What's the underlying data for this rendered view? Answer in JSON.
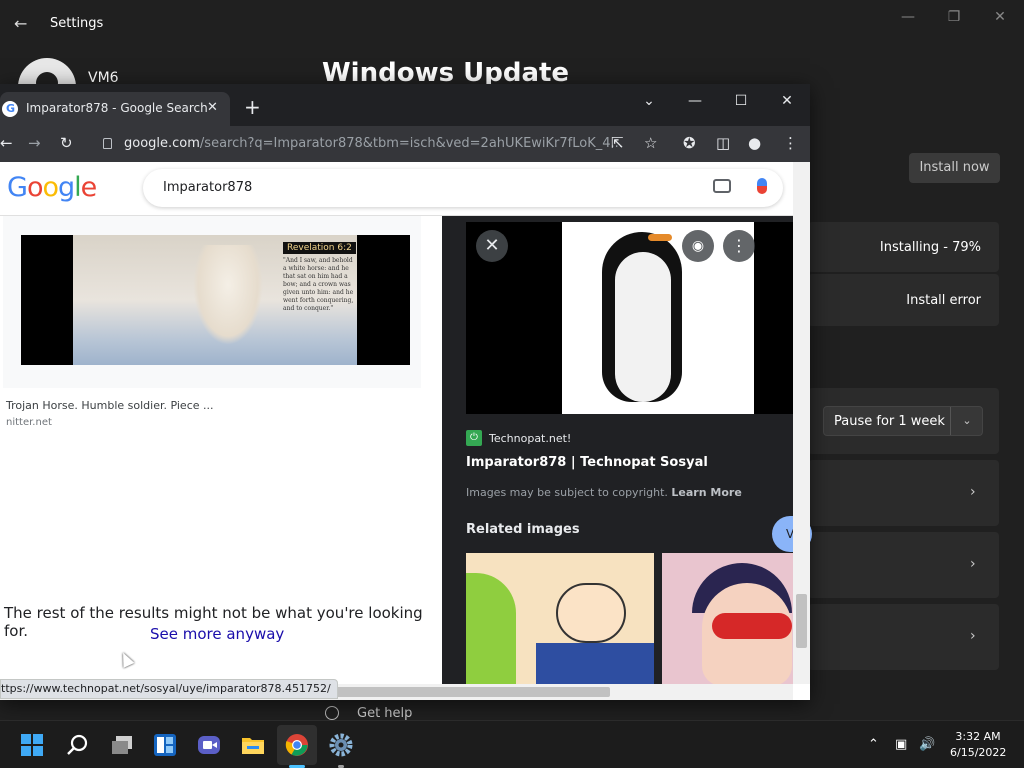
{
  "settings": {
    "title": "Settings",
    "user_name": "VM6",
    "page_title": "Windows Update",
    "install_now_label": "Install now",
    "update_status_1": "Installing - 79%",
    "update_status_2": "Install error",
    "pause_label": "Pause for 1 week",
    "get_help_label": "Get help"
  },
  "chrome": {
    "tab_title": "Imparator878 - Google Search",
    "url_main": "google.com",
    "url_rest": "/search?q=Imparator878&tbm=isch&ved=2ahUKEwiKr7fLoK_4...",
    "status_url": "ttps://www.technopat.net/sosyal/uye/imparator878.451752/"
  },
  "google": {
    "logo_letters": [
      "G",
      "o",
      "o",
      "g",
      "l",
      "e"
    ],
    "search_query": "Imparator878",
    "result1": {
      "caption": "Trojan Horse. Humble soldier. Piece ...",
      "source": "nitter.net",
      "image_label": "Revelation 6:2",
      "image_text": "\"And I saw, and behold a white horse: and he that sat on him had a bow; and a crown was given unto him: and he went forth conquering, and to conquer.\""
    },
    "rest_message": "The rest of the results might not be what you're looking for.",
    "see_more": "See more anyway"
  },
  "preview": {
    "source_name": "Technopat.net!",
    "title": "Imparator878 | Technopat Sosyal",
    "copyright": "Images may be subject to copyright.",
    "learn_more": "Learn More",
    "related_label": "Related images",
    "visit_label": "V"
  },
  "taskbar": {
    "time": "3:32 AM",
    "date": "6/15/2022"
  },
  "colors": {
    "google_blue": "#4285f4",
    "google_red": "#ea4335",
    "google_yellow": "#fbbc05",
    "google_green": "#34a853",
    "link": "#1a0dab",
    "windows_accent": "#3fa9f5"
  }
}
